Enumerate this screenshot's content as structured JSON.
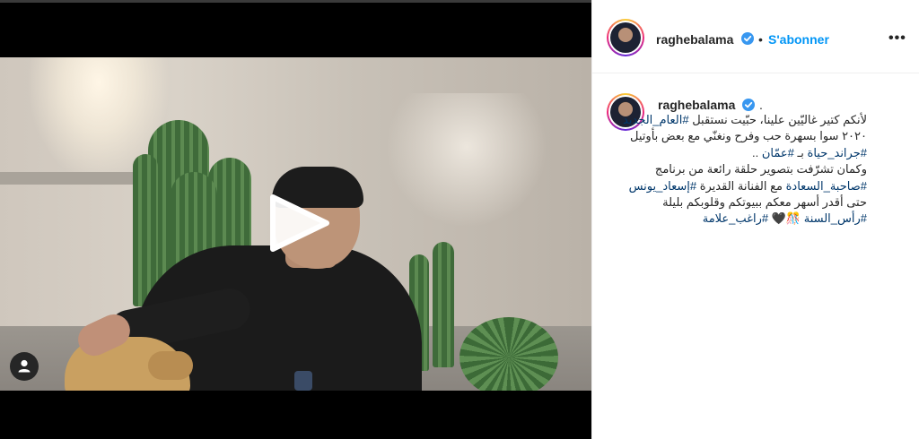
{
  "post": {
    "username": "raghebalama",
    "follow_label": "S'abonner",
    "separator": "•",
    "more_label": "•••",
    "caption_period": "."
  },
  "caption": {
    "l1": {
      "a": "لأنكم كتير غاليّين علينا، حبّيت نستقبل ",
      "tag": "#العام_الجديد"
    },
    "l2": {
      "a": "٢٠٢٠ سوا بسهرة حب وفرح ونغنّي مع بعض بأوتيل"
    },
    "l3": {
      "tag1": "#جراند_حياة",
      "a": " بـ ",
      "tag2": "#عمّان",
      "b": " .."
    },
    "l4": {
      "a": "وكمان تشرّفت بتصوير حلقة رائعة من برنامج"
    },
    "l5": {
      "tag1": "#صاحبة_السعادة",
      "a": " مع الفنانة القديرة ",
      "tag2": "#إسعاد_يونس"
    },
    "l6": {
      "a": "حتى أقدر أسهر معكم ببيوتكم وقلوبكم بليلة"
    },
    "l7": {
      "tag1": "#رأس_السنة",
      "a": " 🎊🖤 ",
      "tag2": "#راغب_علامة"
    }
  },
  "colors": {
    "link": "#0095f6",
    "hashtag": "#00376b",
    "text": "#262626",
    "verified": "#3897f0"
  },
  "icons": {
    "play": "play-icon",
    "user": "user-icon",
    "verified": "verified-badge-icon",
    "more": "more-options-icon"
  }
}
